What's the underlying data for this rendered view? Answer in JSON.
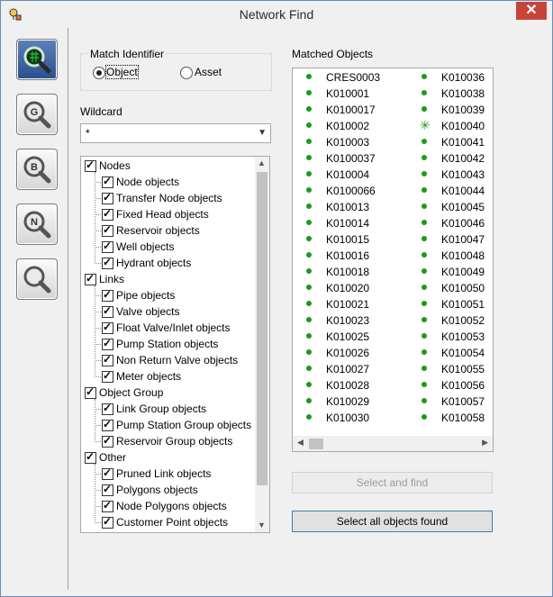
{
  "window": {
    "title": "Network Find",
    "close_label": "✕"
  },
  "toolbar": {
    "items": [
      {
        "letter": "",
        "active": true
      },
      {
        "letter": "G",
        "active": false
      },
      {
        "letter": "B",
        "active": false
      },
      {
        "letter": "N",
        "active": false
      },
      {
        "letter": "",
        "active": false
      }
    ]
  },
  "match_identifier": {
    "label": "Match Identifier",
    "options": [
      {
        "label": "Object",
        "selected": true
      },
      {
        "label": "Asset",
        "selected": false
      }
    ]
  },
  "wildcard": {
    "label": "Wildcard",
    "value": "*"
  },
  "object_tree": [
    {
      "label": "Nodes",
      "level": 0,
      "checked": true
    },
    {
      "label": "Node objects",
      "level": 1,
      "checked": true
    },
    {
      "label": "Transfer Node objects",
      "level": 1,
      "checked": true
    },
    {
      "label": "Fixed Head objects",
      "level": 1,
      "checked": true
    },
    {
      "label": "Reservoir objects",
      "level": 1,
      "checked": true
    },
    {
      "label": "Well objects",
      "level": 1,
      "checked": true
    },
    {
      "label": "Hydrant objects",
      "level": 1,
      "checked": true
    },
    {
      "label": "Links",
      "level": 0,
      "checked": true
    },
    {
      "label": "Pipe objects",
      "level": 1,
      "checked": true
    },
    {
      "label": "Valve objects",
      "level": 1,
      "checked": true
    },
    {
      "label": "Float Valve/Inlet objects",
      "level": 1,
      "checked": true
    },
    {
      "label": "Pump Station objects",
      "level": 1,
      "checked": true
    },
    {
      "label": "Non Return Valve objects",
      "level": 1,
      "checked": true
    },
    {
      "label": "Meter objects",
      "level": 1,
      "checked": true
    },
    {
      "label": "Object Group",
      "level": 0,
      "checked": true
    },
    {
      "label": "Link Group objects",
      "level": 1,
      "checked": true
    },
    {
      "label": "Pump Station Group objects",
      "level": 1,
      "checked": true
    },
    {
      "label": "Reservoir Group objects",
      "level": 1,
      "checked": true
    },
    {
      "label": "Other",
      "level": 0,
      "checked": true
    },
    {
      "label": "Pruned Link objects",
      "level": 1,
      "checked": true
    },
    {
      "label": "Polygons objects",
      "level": 1,
      "checked": true
    },
    {
      "label": "Node Polygons objects",
      "level": 1,
      "checked": true
    },
    {
      "label": "Customer Point objects",
      "level": 1,
      "checked": true
    }
  ],
  "matched_objects": {
    "label": "Matched Objects",
    "column1": [
      "CRES0003",
      "K010001",
      "K0100017",
      "K010002",
      "K010003",
      "K0100037",
      "K010004",
      "K0100066",
      "K010013",
      "K010014",
      "K010015",
      "K010016",
      "K010018",
      "K010020",
      "K010021",
      "K010023",
      "K010025",
      "K010026",
      "K010027",
      "K010028",
      "K010029",
      "K010030"
    ],
    "column2": [
      "K010036",
      "K010038",
      "K010039",
      "K010040",
      "K010041",
      "K010042",
      "K010043",
      "K010044",
      "K010045",
      "K010046",
      "K010047",
      "K010048",
      "K010049",
      "K010050",
      "K010051",
      "K010052",
      "K010053",
      "K010054",
      "K010055",
      "K010056",
      "K010057",
      "K010058"
    ],
    "star_item": "K010040",
    "marker_color": "#1c9a1c"
  },
  "buttons": {
    "select_and_find": "Select and find",
    "select_all": "Select all objects found"
  }
}
